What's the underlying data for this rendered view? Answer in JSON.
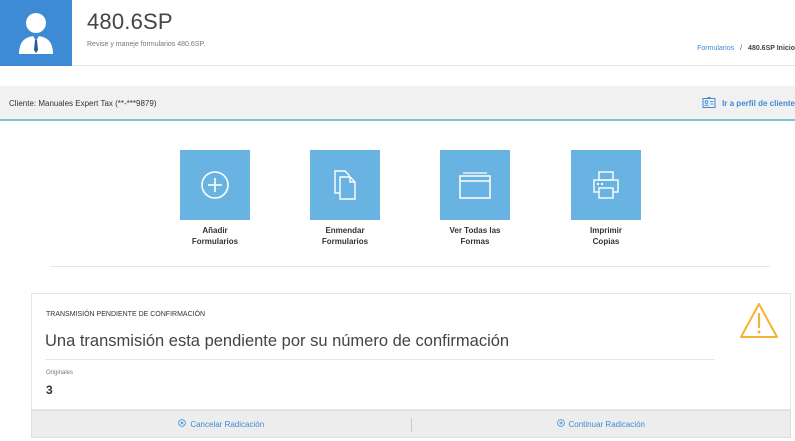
{
  "header": {
    "title": "480.6SP",
    "subtitle": "Revise y maneje formularios 480.6SP.",
    "breadcrumb": {
      "link": "Formularios",
      "separator": "/",
      "current": "480.6SP Inicio"
    },
    "avatar_color": "#3d8bd4"
  },
  "client_bar": {
    "client_label": "Cliente: Manuales Expert Tax (**-***9879)",
    "profile_link": "Ir a perfil de cliente",
    "accent_color": "#7fc4d2"
  },
  "tiles": [
    {
      "icon": "plus-circle-icon",
      "line1": "Añadir",
      "line2": "Formularios"
    },
    {
      "icon": "documents-icon",
      "line1": "Enmendar",
      "line2": "Formularios"
    },
    {
      "icon": "folder-icon",
      "line1": "Ver Todas las",
      "line2": "Formas"
    },
    {
      "icon": "printer-icon",
      "line1": "Imprimir",
      "line2": "Copias"
    }
  ],
  "tile_color": "#69b3e3",
  "pending": {
    "heading": "TRANSMISIÓN PENDIENTE DE CONFIRMACIÓN",
    "message": "Una transmisión esta pendiente por su número de confirmación",
    "count_label": "Originales",
    "count_value": "3",
    "warning_icon": "warning-triangle-icon",
    "warning_color": "#f5b335"
  },
  "actions": {
    "cancel": {
      "icon": "x-circle-icon",
      "label": "Cancelar Radicación"
    },
    "continue": {
      "icon": "plus-circle-small-icon",
      "label": "Continuar Radicación"
    }
  }
}
